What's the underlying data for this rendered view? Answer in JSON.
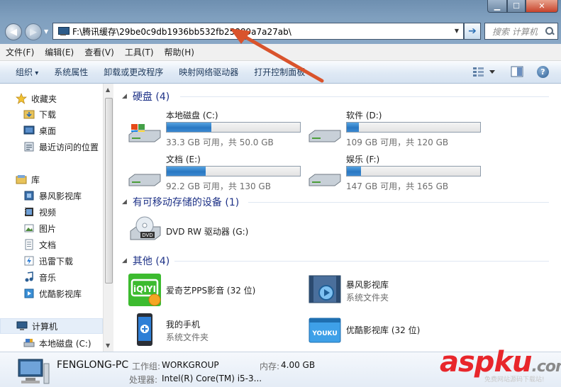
{
  "window": {
    "min_glyph": "▁",
    "max_glyph": "☐",
    "close_glyph": "✕"
  },
  "address_bar": {
    "path": "F:\\腾讯缓存\\29be0c9db1936bb532fb25889a7a27ab\\",
    "search_placeholder": "搜索 计算机"
  },
  "menu": [
    "文件(F)",
    "编辑(E)",
    "查看(V)",
    "工具(T)",
    "帮助(H)"
  ],
  "commands": [
    "组织",
    "系统属性",
    "卸载或更改程序",
    "映射网络驱动器",
    "打开控制面板"
  ],
  "nav": {
    "favorites": {
      "label": "收藏夹",
      "items": [
        "下载",
        "桌面",
        "最近访问的位置"
      ]
    },
    "libraries": {
      "label": "库",
      "items": [
        "暴风影视库",
        "视频",
        "图片",
        "文档",
        "迅雷下载",
        "音乐",
        "优酷影视库"
      ]
    },
    "computer": {
      "label": "计算机",
      "items": [
        "本地磁盘 (C:)"
      ]
    }
  },
  "sections": {
    "hard_disks": "硬盘 (4)",
    "removable": "有可移动存储的设备 (1)",
    "other": "其他 (4)"
  },
  "drives": [
    {
      "name": "本地磁盘 (C:)",
      "free": "33.3 GB 可用，共 50.0 GB",
      "used_fraction": 0.334
    },
    {
      "name": "软件 (D:)",
      "free": "109 GB 可用，共 120 GB",
      "used_fraction": 0.092
    },
    {
      "name": "文档 (E:)",
      "free": "92.2 GB 可用，共 130 GB",
      "used_fraction": 0.291
    },
    {
      "name": "娱乐 (F:)",
      "free": "147 GB 可用，共 165 GB",
      "used_fraction": 0.109
    }
  ],
  "removable": [
    {
      "name": "DVD RW 驱动器 (G:)",
      "icon_text": "DVD"
    }
  ],
  "other_items": [
    {
      "name": "爱奇艺PPS影音 (32 位)",
      "sub": "",
      "icon_text": "iQIYI"
    },
    {
      "name": "暴风影视库",
      "sub": "系统文件夹",
      "icon_text": ""
    },
    {
      "name": "我的手机",
      "sub": "系统文件夹",
      "icon_text": ""
    },
    {
      "name": "优酷影视库 (32 位)",
      "sub": "",
      "icon_text": "YOUKU"
    }
  ],
  "details": {
    "computer_name": "FENGLONG-PC",
    "workgroup_label": "工作组:",
    "workgroup_value": "WORKGROUP",
    "memory_label": "内存:",
    "memory_value": "4.00 GB",
    "cpu_label": "处理器:",
    "cpu_value": "Intel(R) Core(TM) i5-3..."
  },
  "watermark": {
    "a": "asp",
    "b": "ku",
    "c": ".com",
    "sub": "免费网站源码下载站!"
  },
  "colors": {
    "accent": "#1e3287",
    "bar": "#2a78c2",
    "annotation": "#d9532c"
  }
}
